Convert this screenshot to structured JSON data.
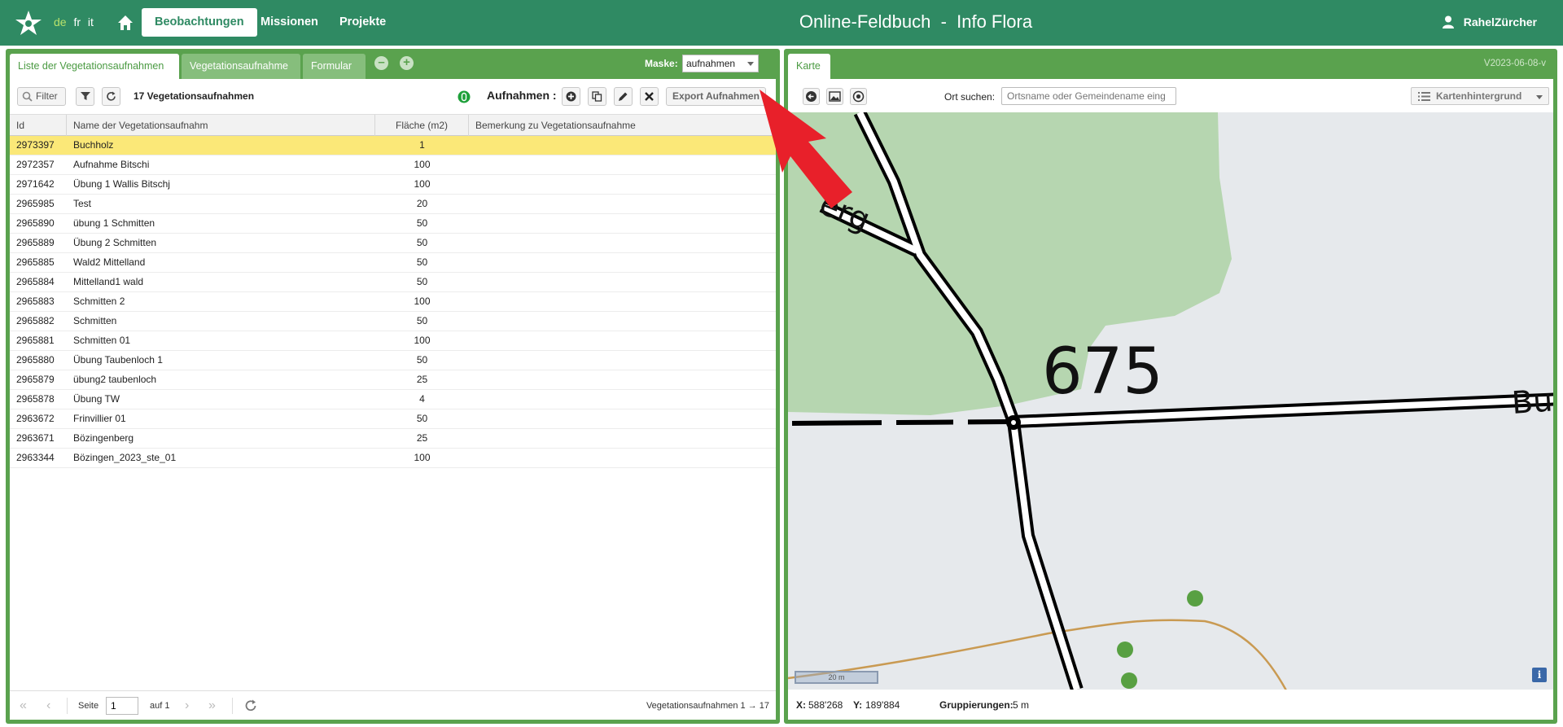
{
  "header": {
    "languages": [
      "de",
      "fr",
      "it"
    ],
    "active_language": "de",
    "nav": [
      "Beobachtungen",
      "Missionen",
      "Projekte"
    ],
    "active_nav": "Beobachtungen",
    "title": "Online-Feldbuch  -  Info Flora",
    "user": "RahelZürcher"
  },
  "left": {
    "tabs": [
      "Liste der Vegetationsaufnahmen",
      "Vegetationsaufnahme",
      "Formular"
    ],
    "maske_label": "Maske:",
    "maske_value": "aufnahmen",
    "toolbar": {
      "filter": "Filter",
      "count_text": "17 Vegetationsaufnahmen",
      "aufnahmen_label": "Aufnahmen :",
      "export": "Export Aufnahmen"
    },
    "columns": [
      "Id",
      "Name der Vegetationsaufnahm",
      "Fläche (m2)",
      "Bemerkung zu Vegetationsaufnahme"
    ],
    "rows": [
      {
        "id": "2973397",
        "name": "Buchholz",
        "flaeche": "1",
        "bemerkung": ""
      },
      {
        "id": "2972357",
        "name": "Aufnahme Bitschi",
        "flaeche": "100",
        "bemerkung": ""
      },
      {
        "id": "2971642",
        "name": "Übung 1 Wallis Bitschj",
        "flaeche": "100",
        "bemerkung": ""
      },
      {
        "id": "2965985",
        "name": "Test",
        "flaeche": "20",
        "bemerkung": ""
      },
      {
        "id": "2965890",
        "name": "übung 1 Schmitten",
        "flaeche": "50",
        "bemerkung": ""
      },
      {
        "id": "2965889",
        "name": "Übung 2 Schmitten",
        "flaeche": "50",
        "bemerkung": ""
      },
      {
        "id": "2965885",
        "name": "Wald2 Mittelland",
        "flaeche": "50",
        "bemerkung": ""
      },
      {
        "id": "2965884",
        "name": "Mittelland1 wald",
        "flaeche": "50",
        "bemerkung": ""
      },
      {
        "id": "2965883",
        "name": "Schmitten 2",
        "flaeche": "100",
        "bemerkung": ""
      },
      {
        "id": "2965882",
        "name": "Schmitten",
        "flaeche": "50",
        "bemerkung": ""
      },
      {
        "id": "2965881",
        "name": "Schmitten 01",
        "flaeche": "100",
        "bemerkung": ""
      },
      {
        "id": "2965880",
        "name": "Übung Taubenloch 1",
        "flaeche": "50",
        "bemerkung": ""
      },
      {
        "id": "2965879",
        "name": "übung2 taubenloch",
        "flaeche": "25",
        "bemerkung": ""
      },
      {
        "id": "2965878",
        "name": "Übung TW",
        "flaeche": "4",
        "bemerkung": ""
      },
      {
        "id": "2963672",
        "name": "Frinvillier 01",
        "flaeche": "50",
        "bemerkung": ""
      },
      {
        "id": "2963671",
        "name": "Bözingenberg",
        "flaeche": "25",
        "bemerkung": ""
      },
      {
        "id": "2963344",
        "name": "Bözingen_2023_ste_01",
        "flaeche": "100",
        "bemerkung": ""
      }
    ],
    "selected_row": 0,
    "pager": {
      "seite_label": "Seite",
      "page": "1",
      "of_label": "auf 1",
      "summary": "Vegetationsaufnahmen 1 → 17"
    }
  },
  "right": {
    "tab": "Karte",
    "version": "V2023-06-08-v",
    "ort_label": "Ort suchen:",
    "ort_placeholder": "Ortsname oder Gemeindename eing",
    "background_button": "Kartenhintergrund",
    "map": {
      "elevation_label": "675",
      "road_label_left": "erg",
      "road_label_right": "Bu",
      "scale_label": "20 m"
    },
    "coords": {
      "x_label": "X:",
      "x_value": "588'268",
      "y_label": "Y:",
      "y_value": "189'884",
      "group_label": "Gruppierungen:",
      "group_value": "5 m"
    }
  },
  "colors": {
    "header": "#2f8a63",
    "panel": "#5aa24e",
    "selected_row": "#fbe878",
    "annotation_arrow": "#e8202a"
  }
}
